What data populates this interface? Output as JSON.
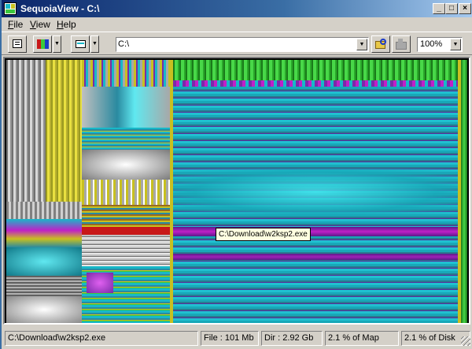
{
  "window": {
    "title": "SequoiaView - C:\\",
    "app_icon": "sequoia-app-icon"
  },
  "title_buttons": {
    "minimize": "_",
    "maximize": "□",
    "close": "×"
  },
  "menu": {
    "items": [
      {
        "label": "File",
        "mnemonic": "F",
        "rest": "ile"
      },
      {
        "label": "View",
        "mnemonic": "V",
        "rest": "iew"
      },
      {
        "label": "Help",
        "mnemonic": "H",
        "rest": "elp"
      }
    ]
  },
  "toolbar": {
    "buttons": [
      "info-icon",
      "colors-icon",
      "filter-icon",
      "search-folder-icon",
      "up-folder-icon"
    ],
    "path_value": "C:\\",
    "zoom_value": "100%"
  },
  "treemap": {
    "tooltip": "C:\\Download\\w2ksp2.exe",
    "colors": {
      "cyan": "#18b8c8",
      "teal": "#2a8aa0",
      "purple": "#7a2aa8",
      "magenta": "#c020c8",
      "yellow": "#c8c020",
      "green": "#3cc83c",
      "gray": "#a8a8a8",
      "red": "#c81818",
      "brown": "#9a6a20"
    }
  },
  "status": {
    "path": "C:\\Download\\w2ksp2.exe",
    "file": "File : 101 Mb",
    "dir": "Dir : 2.92 Gb",
    "map": "2.1 % of Map",
    "disk": "2.1 % of Disk"
  }
}
